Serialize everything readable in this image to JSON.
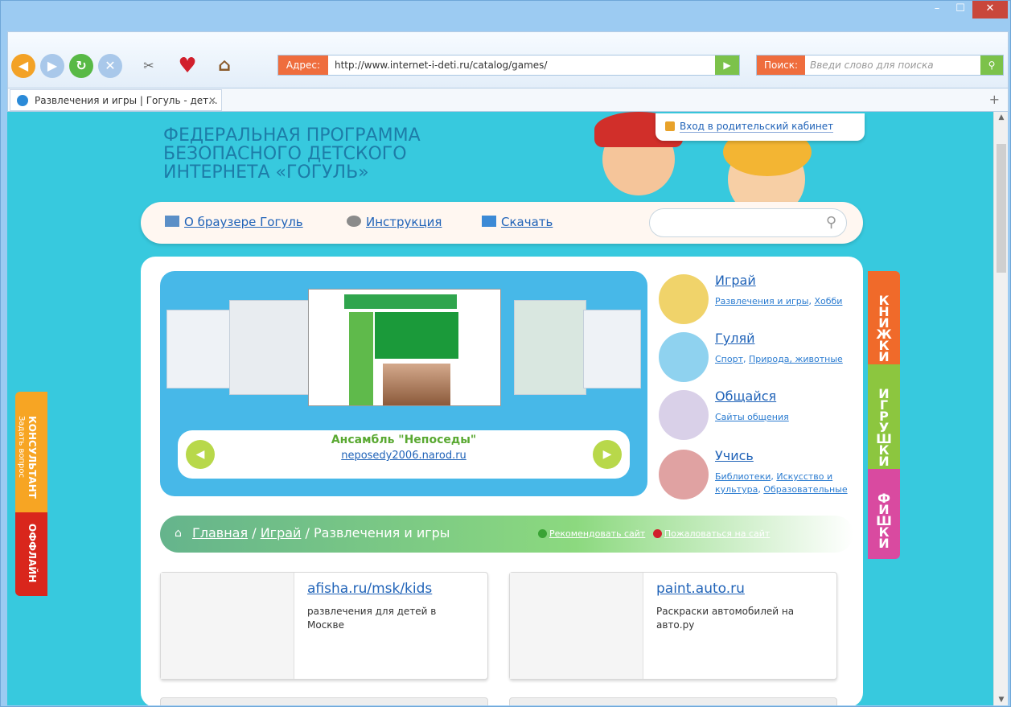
{
  "window": {
    "controls": {
      "minimize": "–",
      "maximize": "☐",
      "close": "✕"
    }
  },
  "toolbar": {
    "address_label": "Адрес:",
    "address_value": "http://www.internet-i-deti.ru/catalog/games/",
    "search_label": "Поиск:",
    "search_placeholder": "Введи слово для поиска"
  },
  "tab": {
    "title": "Развлечения и игры | Гогуль - дет...",
    "close": "✕",
    "new_tab": "+"
  },
  "page": {
    "heading_line1": "ФЕДЕРАЛЬНАЯ ПРОГРАММА",
    "heading_line2": "БЕЗОПАСНОГО ДЕТСКОГО",
    "heading_line3": "ИНТЕРНЕТА «ГОГУЛЬ»",
    "login_link": "Вход в родительский кабинет",
    "menu": {
      "about": "О браузере Гогуль",
      "instructions": "Инструкция",
      "download": "Скачать"
    },
    "carousel": {
      "title": "Ансамбль \"Непоседы\"",
      "url": "neposedy2006.narod.ru"
    },
    "categories": [
      {
        "name": "Играй",
        "subs": [
          "Развлечения и игры",
          "Хобби"
        ]
      },
      {
        "name": "Гуляй",
        "subs": [
          "Спорт",
          "Природа, животные"
        ]
      },
      {
        "name": "Общайся",
        "subs": [
          "Сайты общения"
        ]
      },
      {
        "name": "Учись",
        "subs": [
          "Библиотеки",
          "Искусство и культура",
          "Образовательные"
        ]
      }
    ],
    "breadcrumb": {
      "home": "Главная",
      "sep": "/",
      "level1": "Играй",
      "current": "Развлечения и игры",
      "recommend": "Рекомендовать сайт",
      "complain": "Пожаловаться на сайт"
    },
    "cards": [
      {
        "title": "afisha.ru/msk/kids",
        "desc": "развлечения для детей в Москве"
      },
      {
        "title": "paint.auto.ru",
        "desc": "Раскраски автомобилей на авто.ру"
      }
    ]
  },
  "side_left": {
    "consultant": "КОНСУЛЬТАНТ",
    "ask": "Задать вопрос",
    "offline": "ОФФЛАЙН"
  },
  "side_right": {
    "books": "КНИЖКИ",
    "toys": "ИГРУШКИ",
    "chips": "ФИШКИ"
  },
  "colors": {
    "accent_orange": "#ef6d3d",
    "go_green": "#7cc24a",
    "page_bg": "#37c9de",
    "link_blue": "#2063b8"
  }
}
